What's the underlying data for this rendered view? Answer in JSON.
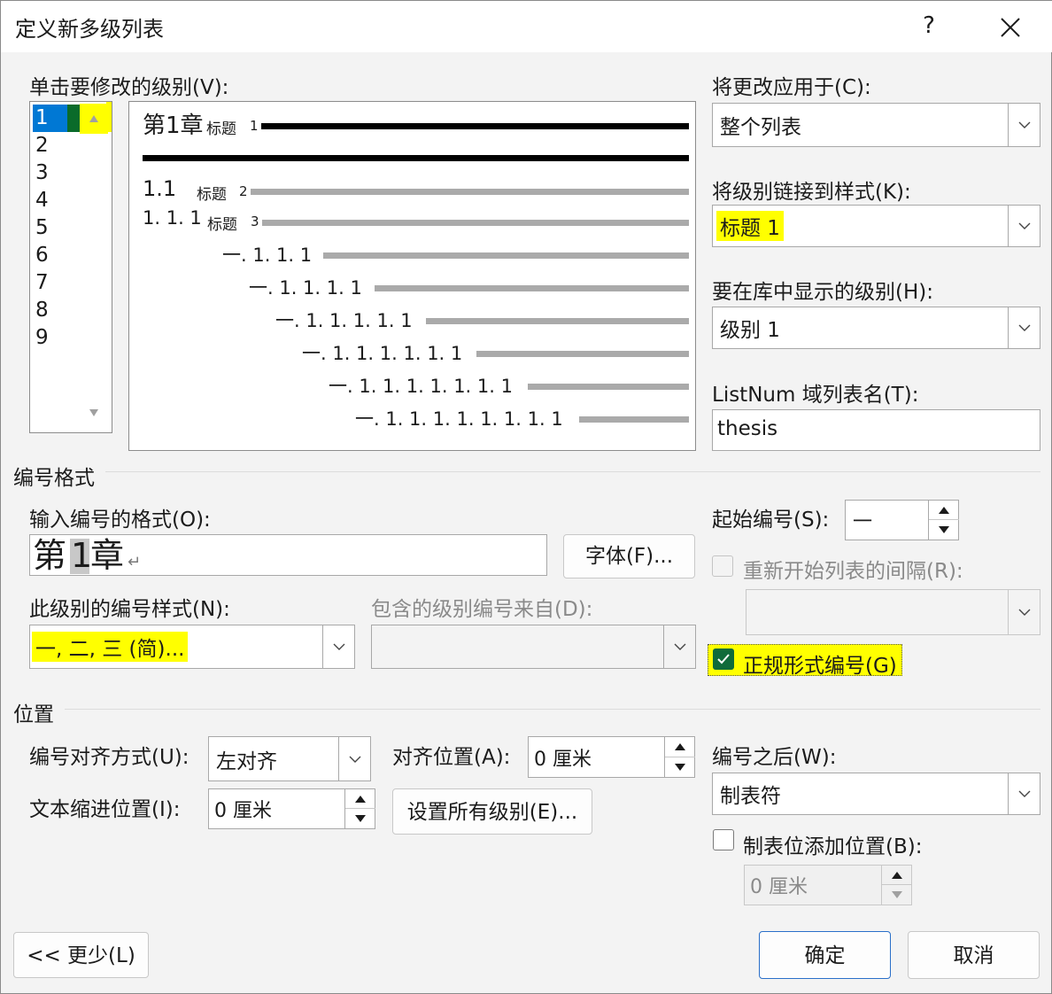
{
  "window": {
    "title": "定义新多级列表",
    "help": "?"
  },
  "levels": {
    "label": "单击要修改的级别(V):",
    "items": [
      "1",
      "2",
      "3",
      "4",
      "5",
      "6",
      "7",
      "8",
      "9"
    ],
    "selected": "1"
  },
  "preview": {
    "rows": [
      {
        "number": "第1章",
        "style": "标题",
        "style_num": "1"
      },
      {
        "number": "1.1",
        "style": "标题",
        "style_num": "2"
      },
      {
        "number": "1. 1. 1",
        "style": "标题",
        "style_num": "3"
      },
      {
        "number": "一. 1. 1. 1"
      },
      {
        "number": "一. 1. 1. 1. 1"
      },
      {
        "number": "一. 1. 1. 1. 1. 1"
      },
      {
        "number": "一. 1. 1. 1. 1. 1. 1"
      },
      {
        "number": "一. 1. 1. 1. 1. 1. 1. 1"
      },
      {
        "number": "一. 1. 1. 1. 1. 1. 1. 1. 1"
      }
    ]
  },
  "apply_to": {
    "label": "将更改应用于(C):",
    "value": "整个列表"
  },
  "link_style": {
    "label": "将级别链接到样式(K):",
    "value": "标题 1"
  },
  "gallery_level": {
    "label": "要在库中显示的级别(H):",
    "value": "级别 1"
  },
  "listnum": {
    "label": "ListNum 域列表名(T):",
    "value": "thesis"
  },
  "number_format": {
    "section": "编号格式",
    "format_label": "输入编号的格式(O):",
    "format_prefix": "第",
    "format_num": "1",
    "format_suffix": "章",
    "return_mark": "↵",
    "font_button": "字体(F)...",
    "style_label": "此级别的编号样式(N):",
    "style_value": "一, 二, 三 (简)...",
    "include_label": "包含的级别编号来自(D):",
    "include_value": ""
  },
  "start_at": {
    "label": "起始编号(S):",
    "value": "一"
  },
  "restart": {
    "label": "重新开始列表的间隔(R):",
    "checked": false,
    "value": ""
  },
  "legal": {
    "label": "正规形式编号(G)",
    "checked": true
  },
  "position": {
    "section": "位置",
    "align_label": "编号对齐方式(U):",
    "align_value": "左对齐",
    "at_label": "对齐位置(A):",
    "at_value": "0 厘米",
    "indent_label": "文本缩进位置(I):",
    "indent_value": "0 厘米",
    "set_all_button": "设置所有级别(E)..."
  },
  "follow": {
    "label": "编号之后(W):",
    "value": "制表符",
    "tab_label": "制表位添加位置(B):",
    "tab_checked": false,
    "tab_value": "0 厘米"
  },
  "buttons": {
    "less": "<< 更少(L)",
    "ok": "确定",
    "cancel": "取消"
  },
  "colors": {
    "highlight": "#ffff00",
    "selection": "#0078d4",
    "check_fill": "#0f6b3a"
  }
}
